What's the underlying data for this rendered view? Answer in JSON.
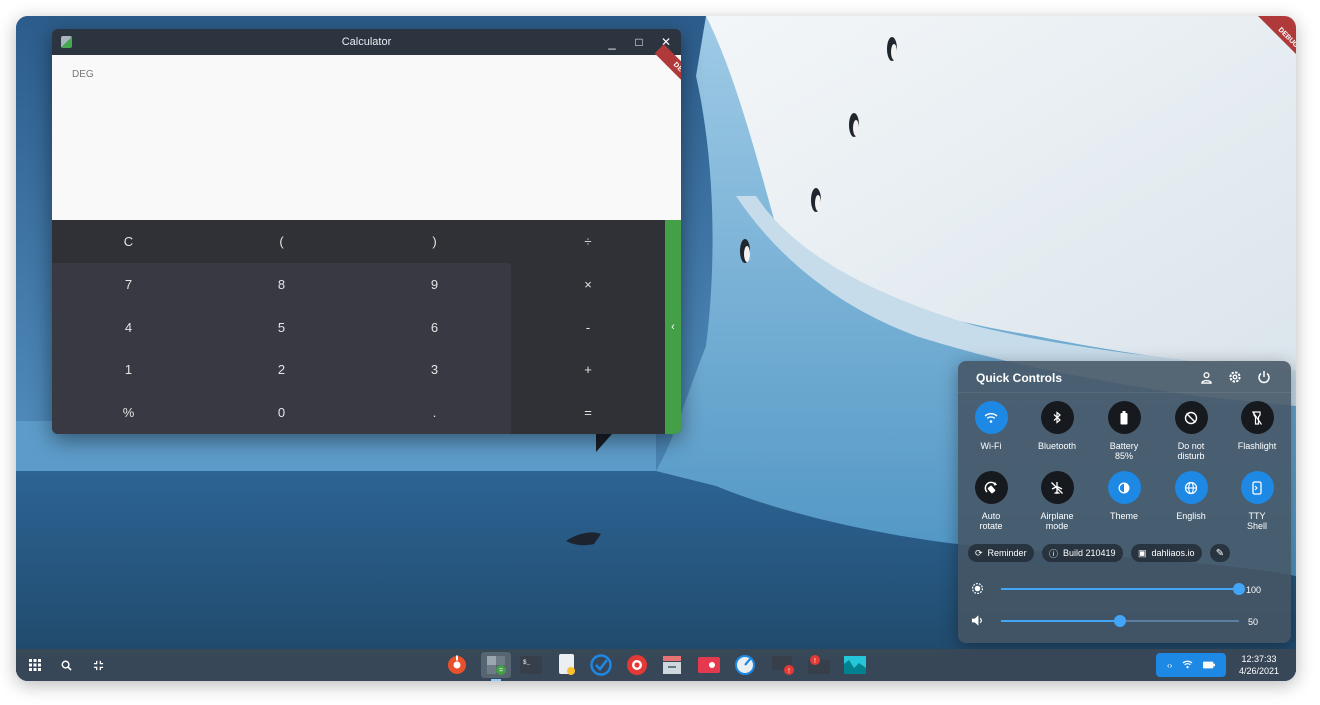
{
  "window": {
    "title": "Calculator",
    "minimize": "_",
    "maximize": "□",
    "close": "✕",
    "debug_label": "DEBUG"
  },
  "calculator": {
    "mode": "DEG",
    "expression": "",
    "keys": {
      "clear": "C",
      "paren_open": "(",
      "paren_close": ")",
      "divide": "÷",
      "seven": "7",
      "eight": "8",
      "nine": "9",
      "multiply": "×",
      "four": "4",
      "five": "5",
      "six": "6",
      "minus": "-",
      "one": "1",
      "two": "2",
      "three": "3",
      "plus": "+",
      "percent": "%",
      "zero": "0",
      "dot": ".",
      "equals": "="
    },
    "advanced_handle": "‹",
    "accent_color": "#43a047"
  },
  "quick_controls": {
    "title": "Quick Controls",
    "header_icons": [
      "account-icon",
      "settings-icon",
      "power-icon"
    ],
    "tiles": [
      {
        "label": "Wi-Fi",
        "active": true
      },
      {
        "label": "Bluetooth",
        "active": false
      },
      {
        "label": "Battery\n85%",
        "active": false
      },
      {
        "label": "Do not\ndisturb",
        "active": false
      },
      {
        "label": "Flashlight",
        "active": false
      },
      {
        "label": "Auto\nrotate",
        "active": false
      },
      {
        "label": "Airplane\nmode",
        "active": false
      },
      {
        "label": "Theme",
        "active": true
      },
      {
        "label": "English",
        "active": true
      },
      {
        "label": "TTY\nShell",
        "active": true
      }
    ],
    "chips": {
      "reminder": "Reminder",
      "build": "Build 210419",
      "site": "dahliaos.io"
    },
    "brightness": {
      "value": 100,
      "label": "100"
    },
    "volume": {
      "value": 50,
      "label": "50"
    },
    "active_color": "#1e88e5"
  },
  "taskbar": {
    "launcher_icon": "apps-grid-icon",
    "search_icon": "search-icon",
    "overview_icon": "overview-icon",
    "apps": [
      "settings",
      "calculator",
      "terminal",
      "notes",
      "tasks",
      "web",
      "files",
      "media",
      "compass",
      "logs",
      "notifications",
      "wallpaper"
    ],
    "time": "12:37:33",
    "date": "4/26/2021"
  }
}
